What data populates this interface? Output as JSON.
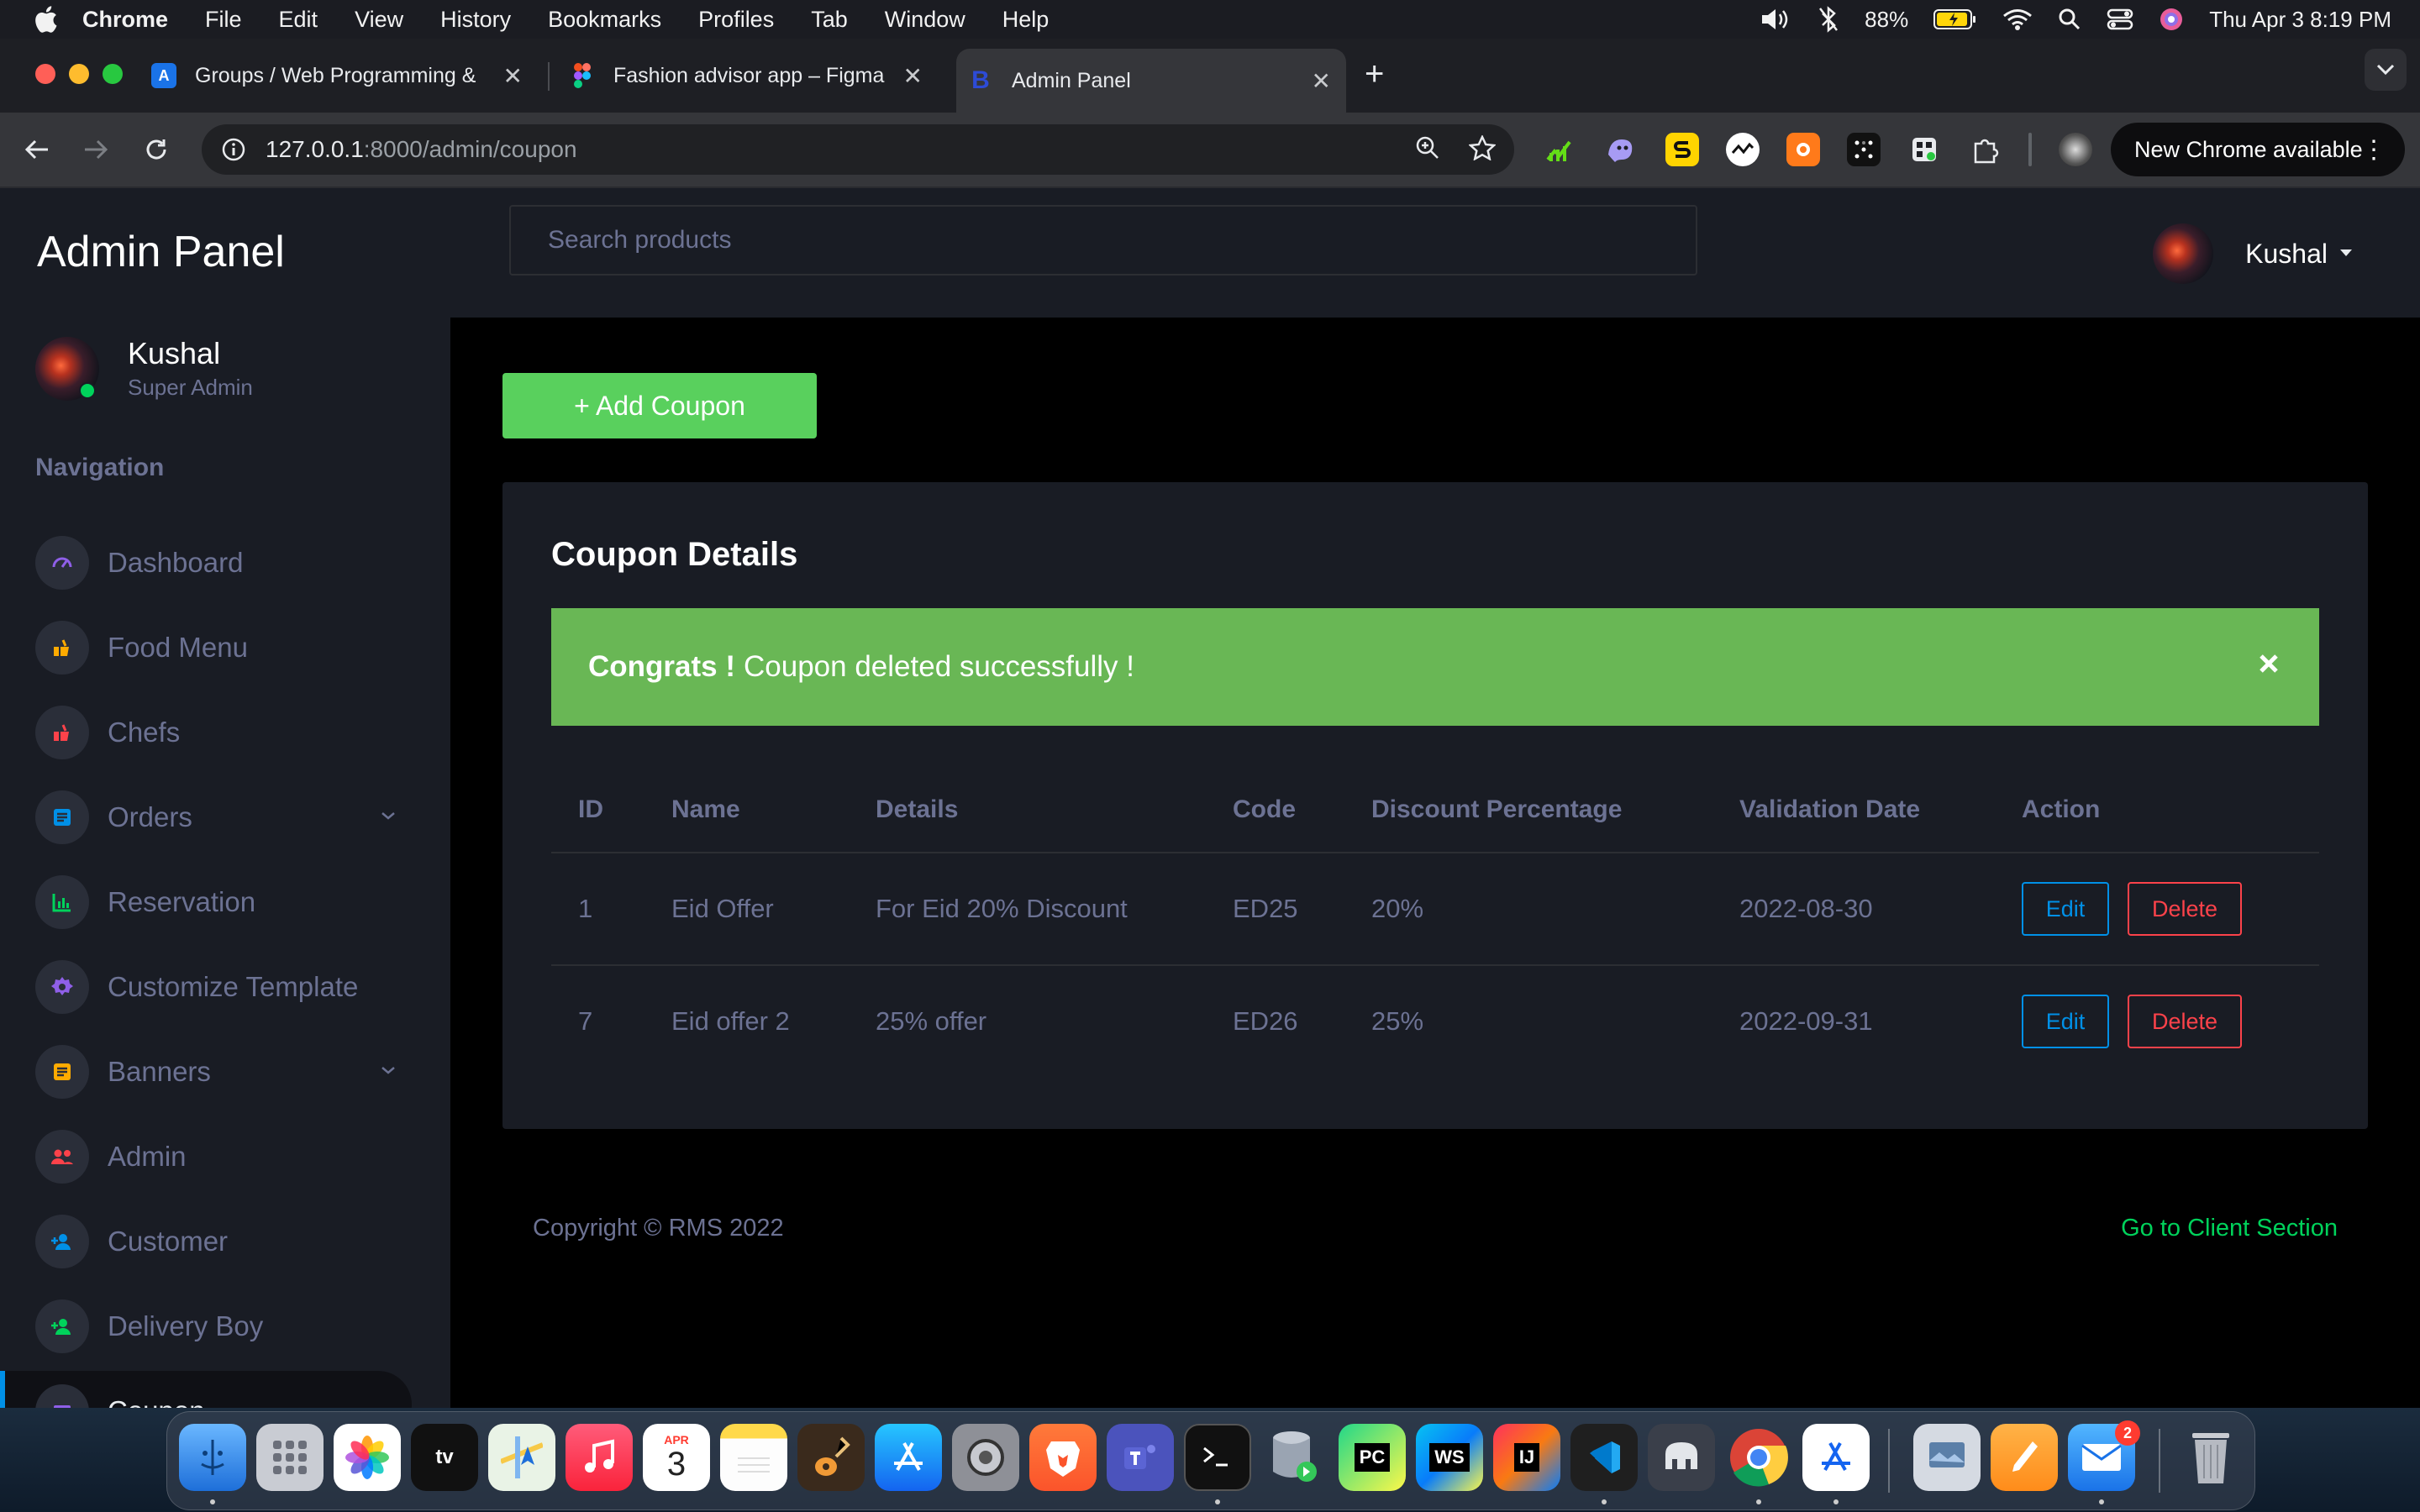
{
  "menubar": {
    "app": "Chrome",
    "items": [
      "File",
      "Edit",
      "View",
      "History",
      "Bookmarks",
      "Profiles",
      "Tab",
      "Window",
      "Help"
    ],
    "battery": "88%",
    "datetime": "Thu Apr 3  8:19 PM"
  },
  "tabs": [
    {
      "title": "Groups / Web Programming & ",
      "favicon": "A",
      "color": "#1a73e8"
    },
    {
      "title": "Fashion advisor app – Figma",
      "favicon": "figma",
      "color": "#f24e1e"
    },
    {
      "title": "Admin Panel",
      "favicon": "B",
      "color": "#2d4bd6"
    }
  ],
  "toolbar": {
    "url_host": "127.0.0.1",
    "url_rest": ":8000/admin/coupon",
    "new_chrome": "New Chrome available"
  },
  "app": {
    "brand": "Admin Panel",
    "user": {
      "name": "Kushal",
      "role": "Super Admin"
    },
    "nav_heading": "Navigation",
    "nav": [
      {
        "label": "Dashboard",
        "icon": "speedometer-icon",
        "color": "#8f5fe8"
      },
      {
        "label": "Food Menu",
        "icon": "food-icon",
        "color": "#ffab00"
      },
      {
        "label": "Chefs",
        "icon": "chef-icon",
        "color": "#fc424a"
      },
      {
        "label": "Orders",
        "icon": "orders-icon",
        "color": "#0090e7"
      },
      {
        "label": "Reservation",
        "icon": "chart-icon",
        "color": "#00d25b"
      },
      {
        "label": "Customize Template",
        "icon": "cog-icon",
        "color": "#8f5fe8"
      },
      {
        "label": "Banners",
        "icon": "banner-icon",
        "color": "#ffab00"
      },
      {
        "label": "Admin",
        "icon": "users-icon",
        "color": "#fc424a"
      },
      {
        "label": "Customer",
        "icon": "user-add-icon",
        "color": "#0090e7"
      },
      {
        "label": "Delivery Boy",
        "icon": "user-add-icon",
        "color": "#00d25b"
      },
      {
        "label": "Coupon",
        "icon": "coupon-icon",
        "color": "#8f5fe8"
      }
    ],
    "search_placeholder": "Search products",
    "add_button": "+ Add Coupon",
    "card_title": "Coupon Details",
    "alert": {
      "strong": "Congrats !",
      "message": "Coupon deleted successfully !"
    },
    "table": {
      "headers": [
        "ID",
        "Name",
        "Details",
        "Code",
        "Discount Percentage",
        "Validation Date",
        "Action"
      ],
      "rows": [
        {
          "id": "1",
          "name": "Eid Offer",
          "details": "For Eid 20% Discount",
          "code": "ED25",
          "discount": "20%",
          "date": "2022-08-30"
        },
        {
          "id": "7",
          "name": "Eid offer 2",
          "details": "25% offer",
          "code": "ED26",
          "discount": "25%",
          "date": "2022-09-31"
        }
      ],
      "edit_label": "Edit",
      "delete_label": "Delete"
    },
    "footer": {
      "copyright": "Copyright © RMS 2022",
      "link": "Go to Client Section"
    }
  },
  "dock": {
    "calendar_month": "APR",
    "calendar_day": "3",
    "mail_badge": "2",
    "tv_label": "tv",
    "pycharm_label": "PC",
    "webstorm_label": "WS",
    "intellij_label": "IJ"
  }
}
